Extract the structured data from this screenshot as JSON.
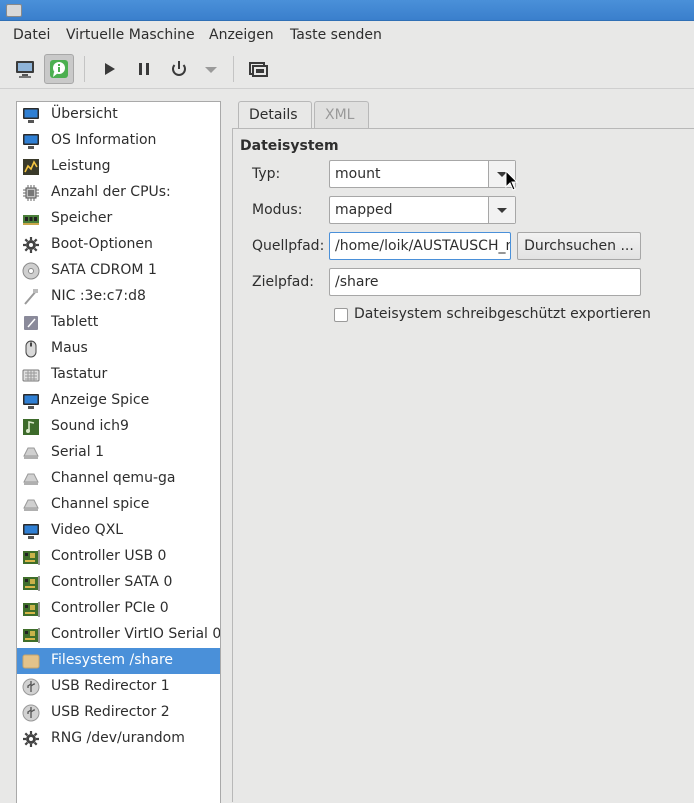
{
  "menubar": {
    "items": [
      "Datei",
      "Virtuelle Maschine",
      "Anzeigen",
      "Taste senden"
    ]
  },
  "toolbar": {
    "buttons": [
      {
        "icon": "monitor-icon",
        "active": false
      },
      {
        "icon": "info-icon",
        "active": true
      },
      {
        "icon": "play-icon",
        "active": false
      },
      {
        "icon": "pause-icon",
        "active": false
      },
      {
        "icon": "power-icon",
        "active": false
      },
      {
        "icon": "chevron-down-icon",
        "active": false
      },
      {
        "icon": "fullscreen-icon",
        "active": false
      }
    ]
  },
  "sidebar": {
    "items": [
      {
        "label": "Übersicht",
        "icon": "monitor-icon"
      },
      {
        "label": "OS Information",
        "icon": "monitor-icon"
      },
      {
        "label": "Leistung",
        "icon": "chart-icon"
      },
      {
        "label": "Anzahl der CPUs:",
        "icon": "cpu-icon"
      },
      {
        "label": "Speicher",
        "icon": "memory-icon"
      },
      {
        "label": "Boot-Optionen",
        "icon": "gear-icon"
      },
      {
        "label": "SATA CDROM 1",
        "icon": "cdrom-icon"
      },
      {
        "label": "NIC :3e:c7:d8",
        "icon": "network-icon"
      },
      {
        "label": "Tablett",
        "icon": "tablet-icon"
      },
      {
        "label": "Maus",
        "icon": "mouse-icon"
      },
      {
        "label": "Tastatur",
        "icon": "keyboard-icon"
      },
      {
        "label": "Anzeige Spice",
        "icon": "monitor-icon"
      },
      {
        "label": "Sound ich9",
        "icon": "sound-icon"
      },
      {
        "label": "Serial 1",
        "icon": "serial-icon"
      },
      {
        "label": "Channel qemu-ga",
        "icon": "serial-icon"
      },
      {
        "label": "Channel spice",
        "icon": "serial-icon"
      },
      {
        "label": "Video QXL",
        "icon": "monitor-icon"
      },
      {
        "label": "Controller USB 0",
        "icon": "controller-icon"
      },
      {
        "label": "Controller SATA 0",
        "icon": "controller-icon"
      },
      {
        "label": "Controller PCIe 0",
        "icon": "controller-icon"
      },
      {
        "label": "Controller VirtIO Serial 0",
        "icon": "controller-icon"
      },
      {
        "label": "Filesystem /share",
        "icon": "folder-icon"
      },
      {
        "label": "USB Redirector 1",
        "icon": "usb-icon"
      },
      {
        "label": "USB Redirector 2",
        "icon": "usb-icon"
      },
      {
        "label": "RNG /dev/urandom",
        "icon": "gear-icon"
      }
    ],
    "selected_label": "Filesystem /share"
  },
  "tabs": {
    "details": "Details",
    "xml": "XML",
    "active": "Details"
  },
  "filesystem": {
    "section_title": "Dateisystem",
    "type_label": "Typ:",
    "type_value": "mount",
    "mode_label": "Modus:",
    "mode_value": "mapped",
    "source_label": "Quellpfad:",
    "source_value": "/home/loik/AUSTAUSCH_m",
    "browse_label": "Durchsuchen ...",
    "target_label": "Zielpfad:",
    "target_value": "/share",
    "readonly_label": "Dateisystem schreibgeschützt exportieren",
    "readonly_checked": false
  },
  "colors": {
    "accent": "#4a90d9",
    "selection_text": "#ffffff"
  }
}
